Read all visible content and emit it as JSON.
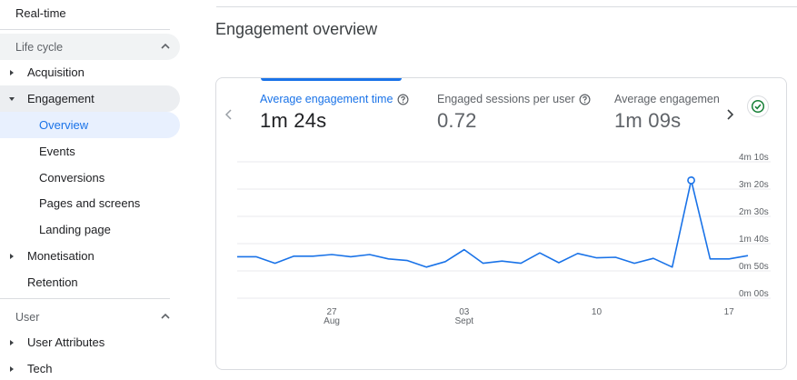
{
  "sidebar": {
    "realtime": "Real-time",
    "lifecycle": {
      "header": "Life cycle",
      "items": [
        {
          "label": "Acquisition"
        },
        {
          "label": "Engagement"
        },
        {
          "label": "Overview"
        },
        {
          "label": "Events"
        },
        {
          "label": "Conversions"
        },
        {
          "label": "Pages and screens"
        },
        {
          "label": "Landing page"
        },
        {
          "label": "Monetisation"
        },
        {
          "label": "Retention"
        }
      ]
    },
    "user": {
      "header": "User",
      "items": [
        {
          "label": "User Attributes"
        },
        {
          "label": "Tech"
        }
      ]
    }
  },
  "main": {
    "title": "Engagement overview",
    "metrics": [
      {
        "label": "Average engagement time",
        "value": "1m 24s"
      },
      {
        "label": "Engaged sessions per user",
        "value": "0.72"
      },
      {
        "label": "Average engagement",
        "value": "1m 09s"
      }
    ],
    "colors": {
      "accent": "#1a73e8",
      "success": "#188038"
    }
  },
  "chart_data": {
    "type": "line",
    "x_labels": [
      {
        "day": "27",
        "month": "Aug"
      },
      {
        "day": "03",
        "month": "Sept"
      },
      {
        "day": "10",
        "month": ""
      },
      {
        "day": "17",
        "month": ""
      }
    ],
    "x_label_index": [
      5,
      12,
      19,
      26
    ],
    "y_ticks": [
      "4m 10s",
      "3m 20s",
      "2m 30s",
      "1m 40s",
      "0m 50s",
      "0m 00s"
    ],
    "y_tick_seconds": [
      250,
      200,
      150,
      100,
      50,
      0
    ],
    "ylim_seconds": [
      0,
      250
    ],
    "series": [
      {
        "values_seconds": [
          76,
          76,
          64,
          77,
          77,
          80,
          76,
          80,
          72,
          69,
          57,
          67,
          89,
          64,
          68,
          64,
          83,
          65,
          82,
          74,
          75,
          64,
          73,
          57,
          216,
          72,
          72,
          78
        ]
      }
    ],
    "highlight_index": 24,
    "grid": true
  }
}
